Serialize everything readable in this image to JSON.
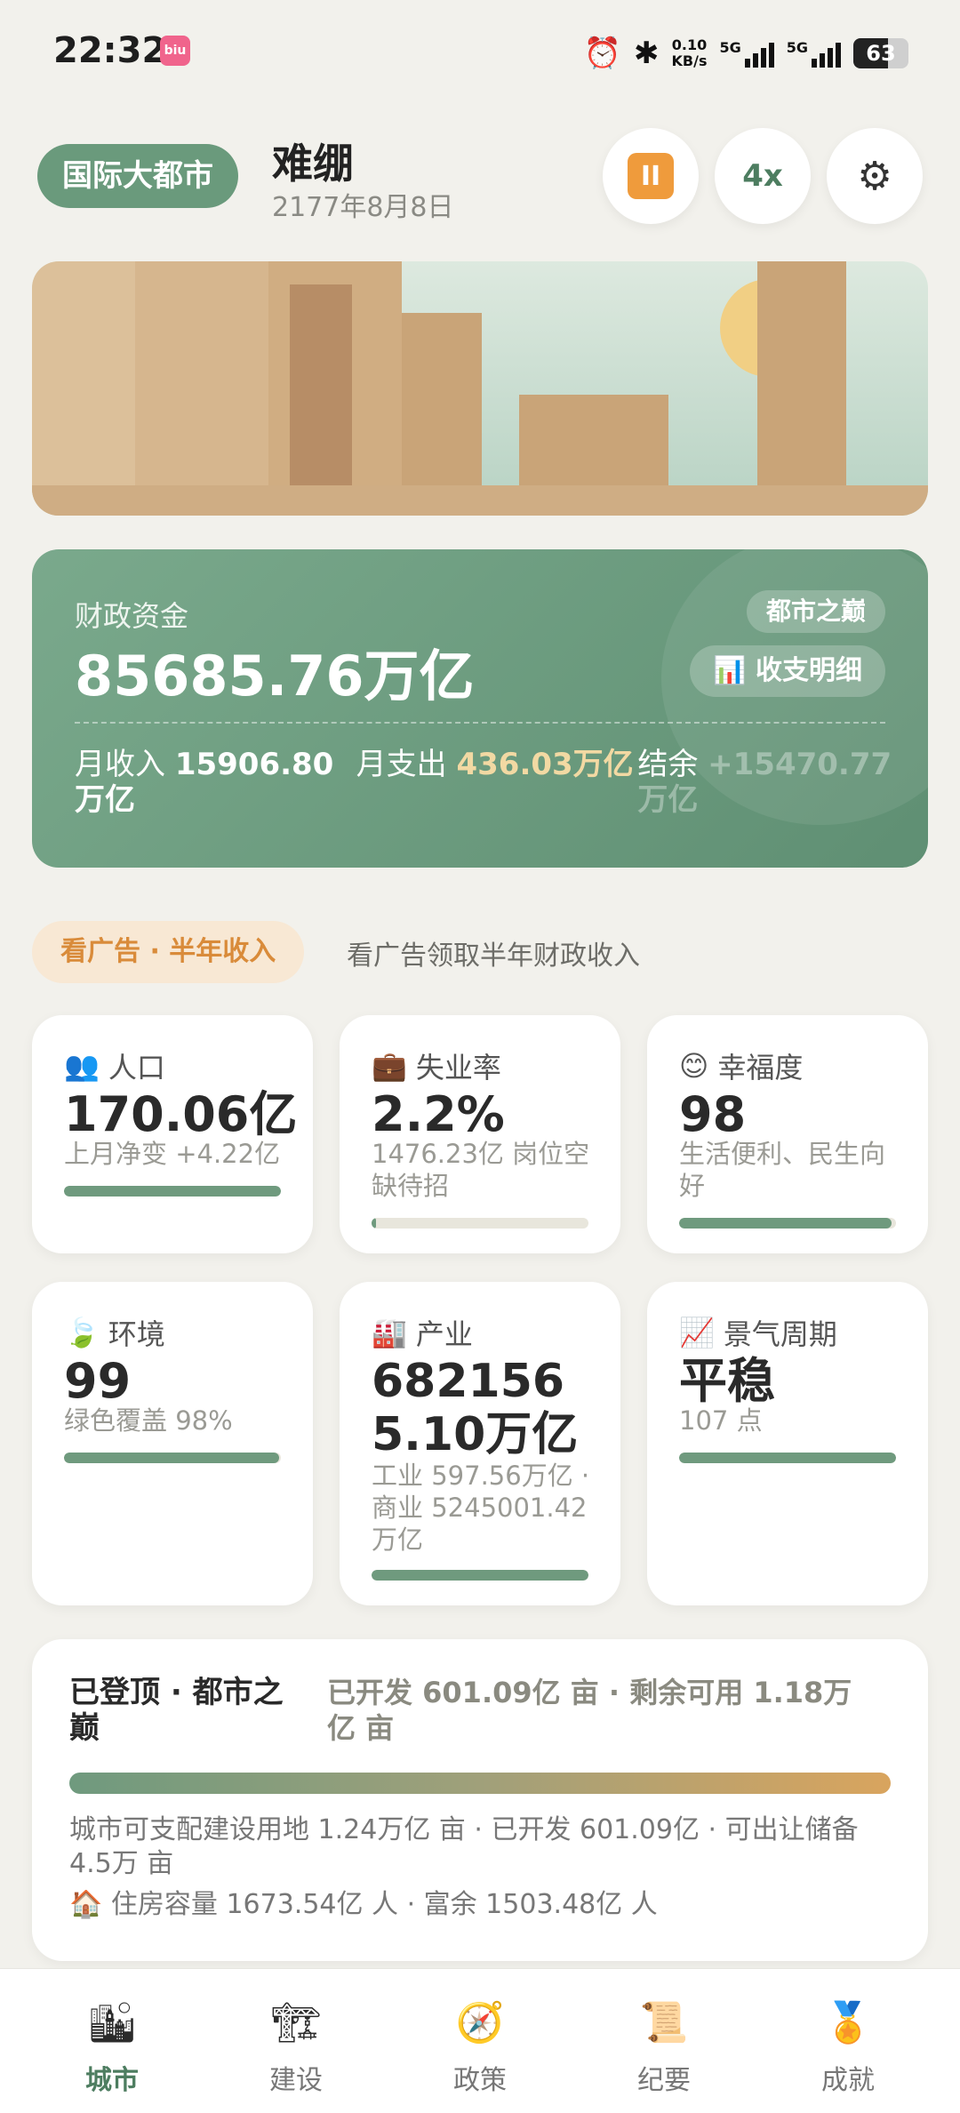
{
  "status_bar": {
    "time": "22:32",
    "net_speed_value": "0.10",
    "net_speed_unit": "KB/s",
    "network_1": "5G",
    "network_2": "5G",
    "battery": "63",
    "battery_level": 0.63,
    "icons": [
      "alarm-icon",
      "bluetooth-icon",
      "signal-icon",
      "battery-icon"
    ]
  },
  "header": {
    "city_tier": "国际大都市",
    "city_name": "难绷",
    "date": "2177年8月8日",
    "pause_label": "II",
    "speed_label": "4x",
    "settings_icon": "gear-icon"
  },
  "finance": {
    "label": "财政资金",
    "amount": "85685.76万亿",
    "tag": "都市之巅",
    "detail_button": "收支明细",
    "income_label": "月收入",
    "income_value": "15906.80万亿",
    "expense_label": "月支出",
    "expense_value": "436.03万亿",
    "balance_label": "结余",
    "balance_value": "+15470.77万亿"
  },
  "ad": {
    "button": "看广告 · 半年收入",
    "text": "看广告领取半年财政收入"
  },
  "stats": [
    {
      "icon": "people-icon",
      "glyph": "👥",
      "label": "人口",
      "value": "170.06亿",
      "sub": "上月净变 +4.22亿",
      "progress": 1.0
    },
    {
      "icon": "briefcase-icon",
      "glyph": "💼",
      "label": "失业率",
      "value": "2.2%",
      "sub": "1476.23亿 岗位空缺待招",
      "progress": 0.02
    },
    {
      "icon": "smile-icon",
      "glyph": "😊",
      "label": "幸福度",
      "value": "98",
      "sub": "生活便利、民生向好",
      "progress": 0.98
    },
    {
      "icon": "leaf-icon",
      "glyph": "🍃",
      "label": "环境",
      "value": "99",
      "sub": "绿色覆盖 98%",
      "progress": 0.99
    },
    {
      "icon": "factory-icon",
      "glyph": "🏭",
      "label": "产业",
      "value": "6821565.10万亿",
      "sub": "工业 597.56万亿 · 商业 5245001.42万亿",
      "progress": 1.0
    },
    {
      "icon": "trend-icon",
      "glyph": "📈",
      "label": "景气周期",
      "value": "平稳",
      "sub": "107 点",
      "progress": 1.0
    }
  ],
  "land": {
    "title": "已登顶 · 都市之巅",
    "developed": "已开发 601.09亿 亩 · 剩余可用 1.18万亿 亩",
    "line1": "城市可支配建设用地 1.24万亿 亩 · 已开发 601.09亿 · 可出让储备 4.5万 亩",
    "line2": "住房容量 1673.54亿 人 · 富余 1503.48亿 人",
    "progress": 1.0
  },
  "nav": [
    {
      "label": "城市",
      "icon": "city-icon",
      "glyph": "🏙",
      "active": true
    },
    {
      "label": "建设",
      "icon": "crane-icon",
      "glyph": "🏗",
      "active": false
    },
    {
      "label": "政策",
      "icon": "compass-icon",
      "glyph": "🧭",
      "active": false
    },
    {
      "label": "纪要",
      "icon": "scroll-icon",
      "glyph": "📜",
      "active": false
    },
    {
      "label": "成就",
      "icon": "medal-icon",
      "glyph": "🏅",
      "active": false
    }
  ],
  "colors": {
    "primary_green": "#6a9a7c",
    "accent_orange": "#ef9b3c",
    "expense_value": "#f2d9a3",
    "background": "#f2f1ec"
  }
}
